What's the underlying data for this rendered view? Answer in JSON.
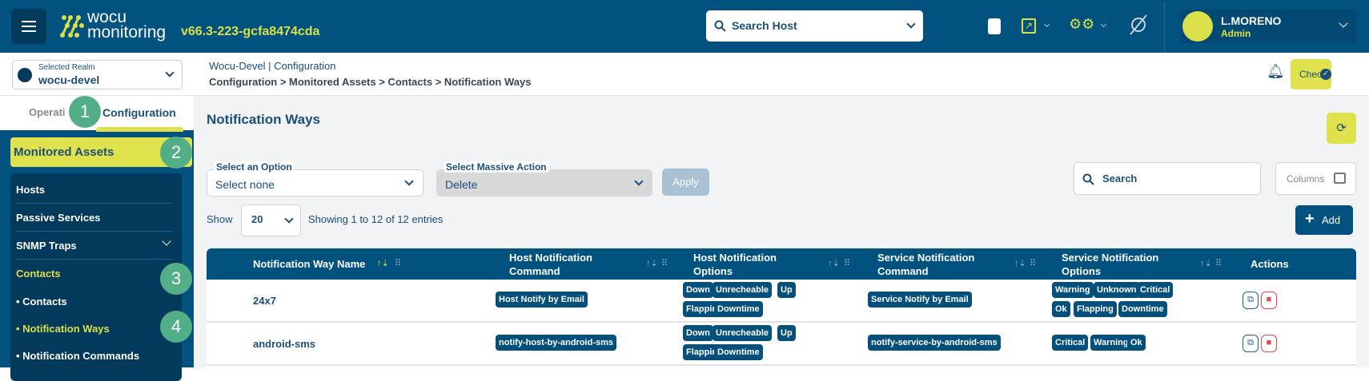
{
  "header": {
    "logo_line1": "wocu",
    "logo_line2": "monitoring",
    "version": "v66.3-223-gcfa8474cda",
    "search_host_placeholder": "Search Host",
    "user_name": "L.MORENO",
    "user_role": "Admin",
    "icons": [
      "menu-icon",
      "book-icon",
      "external-link-icon",
      "gears-icon",
      "sync-off-icon",
      "avatar-icon"
    ]
  },
  "subheader": {
    "realm_label": "Selected Realm",
    "realm_value": "wocu-devel",
    "context": "Wocu-Devel | Configuration",
    "breadcrumb": "Configuration > Monitored Assets > Contacts > Notification Ways",
    "check_label": "Check"
  },
  "sidebar": {
    "tabs": [
      "Operati",
      "Configuration"
    ],
    "section": "Monitored Assets",
    "items": [
      "Hosts",
      "Passive Services",
      "SNMP Traps",
      "Contacts"
    ],
    "subitems": [
      "Contacts",
      "Notification Ways",
      "Notification Commands"
    ],
    "markers": [
      "1",
      "2",
      "3",
      "4"
    ]
  },
  "main": {
    "title": "Notification Ways",
    "select_option_label": "Select an Option",
    "select_option_value": "Select none",
    "massive_label": "Select Massive Action",
    "massive_value": "Delete",
    "apply_label": "Apply",
    "show_label": "Show",
    "show_value": "20",
    "showing_text": "Showing 1 to 12 of 12 entries",
    "search_placeholder": "Search",
    "columns_label": "Columns",
    "add_label": "Add"
  },
  "table": {
    "headers": [
      "Notification Way Name",
      "Host Notification Command",
      "Host Notification Options",
      "Service Notification Command",
      "Service Notification Options",
      "Actions"
    ],
    "rows": [
      {
        "name": "24x7",
        "host_cmd": "Host Notify by Email",
        "host_opts": [
          "Down",
          "Unrecheable",
          "Up",
          "Flapping",
          "Downtime"
        ],
        "svc_cmd": "Service Notify by Email",
        "svc_opts": [
          "Warning",
          "Unknown",
          "Critical",
          "Ok",
          "Flapping",
          "Downtime"
        ]
      },
      {
        "name": "android-sms",
        "host_cmd": "notify-host-by-android-sms",
        "host_opts": [
          "Down",
          "Unrecheable",
          "Up",
          "Flapping",
          "Downtime"
        ],
        "svc_cmd": "notify-service-by-android-sms",
        "svc_opts": [
          "Critical",
          "Warning",
          "Ok"
        ]
      }
    ]
  },
  "colors": {
    "primary": "#02527f",
    "accent": "#d9e04a",
    "marker": "#52ae86",
    "danger": "#e8474c"
  }
}
